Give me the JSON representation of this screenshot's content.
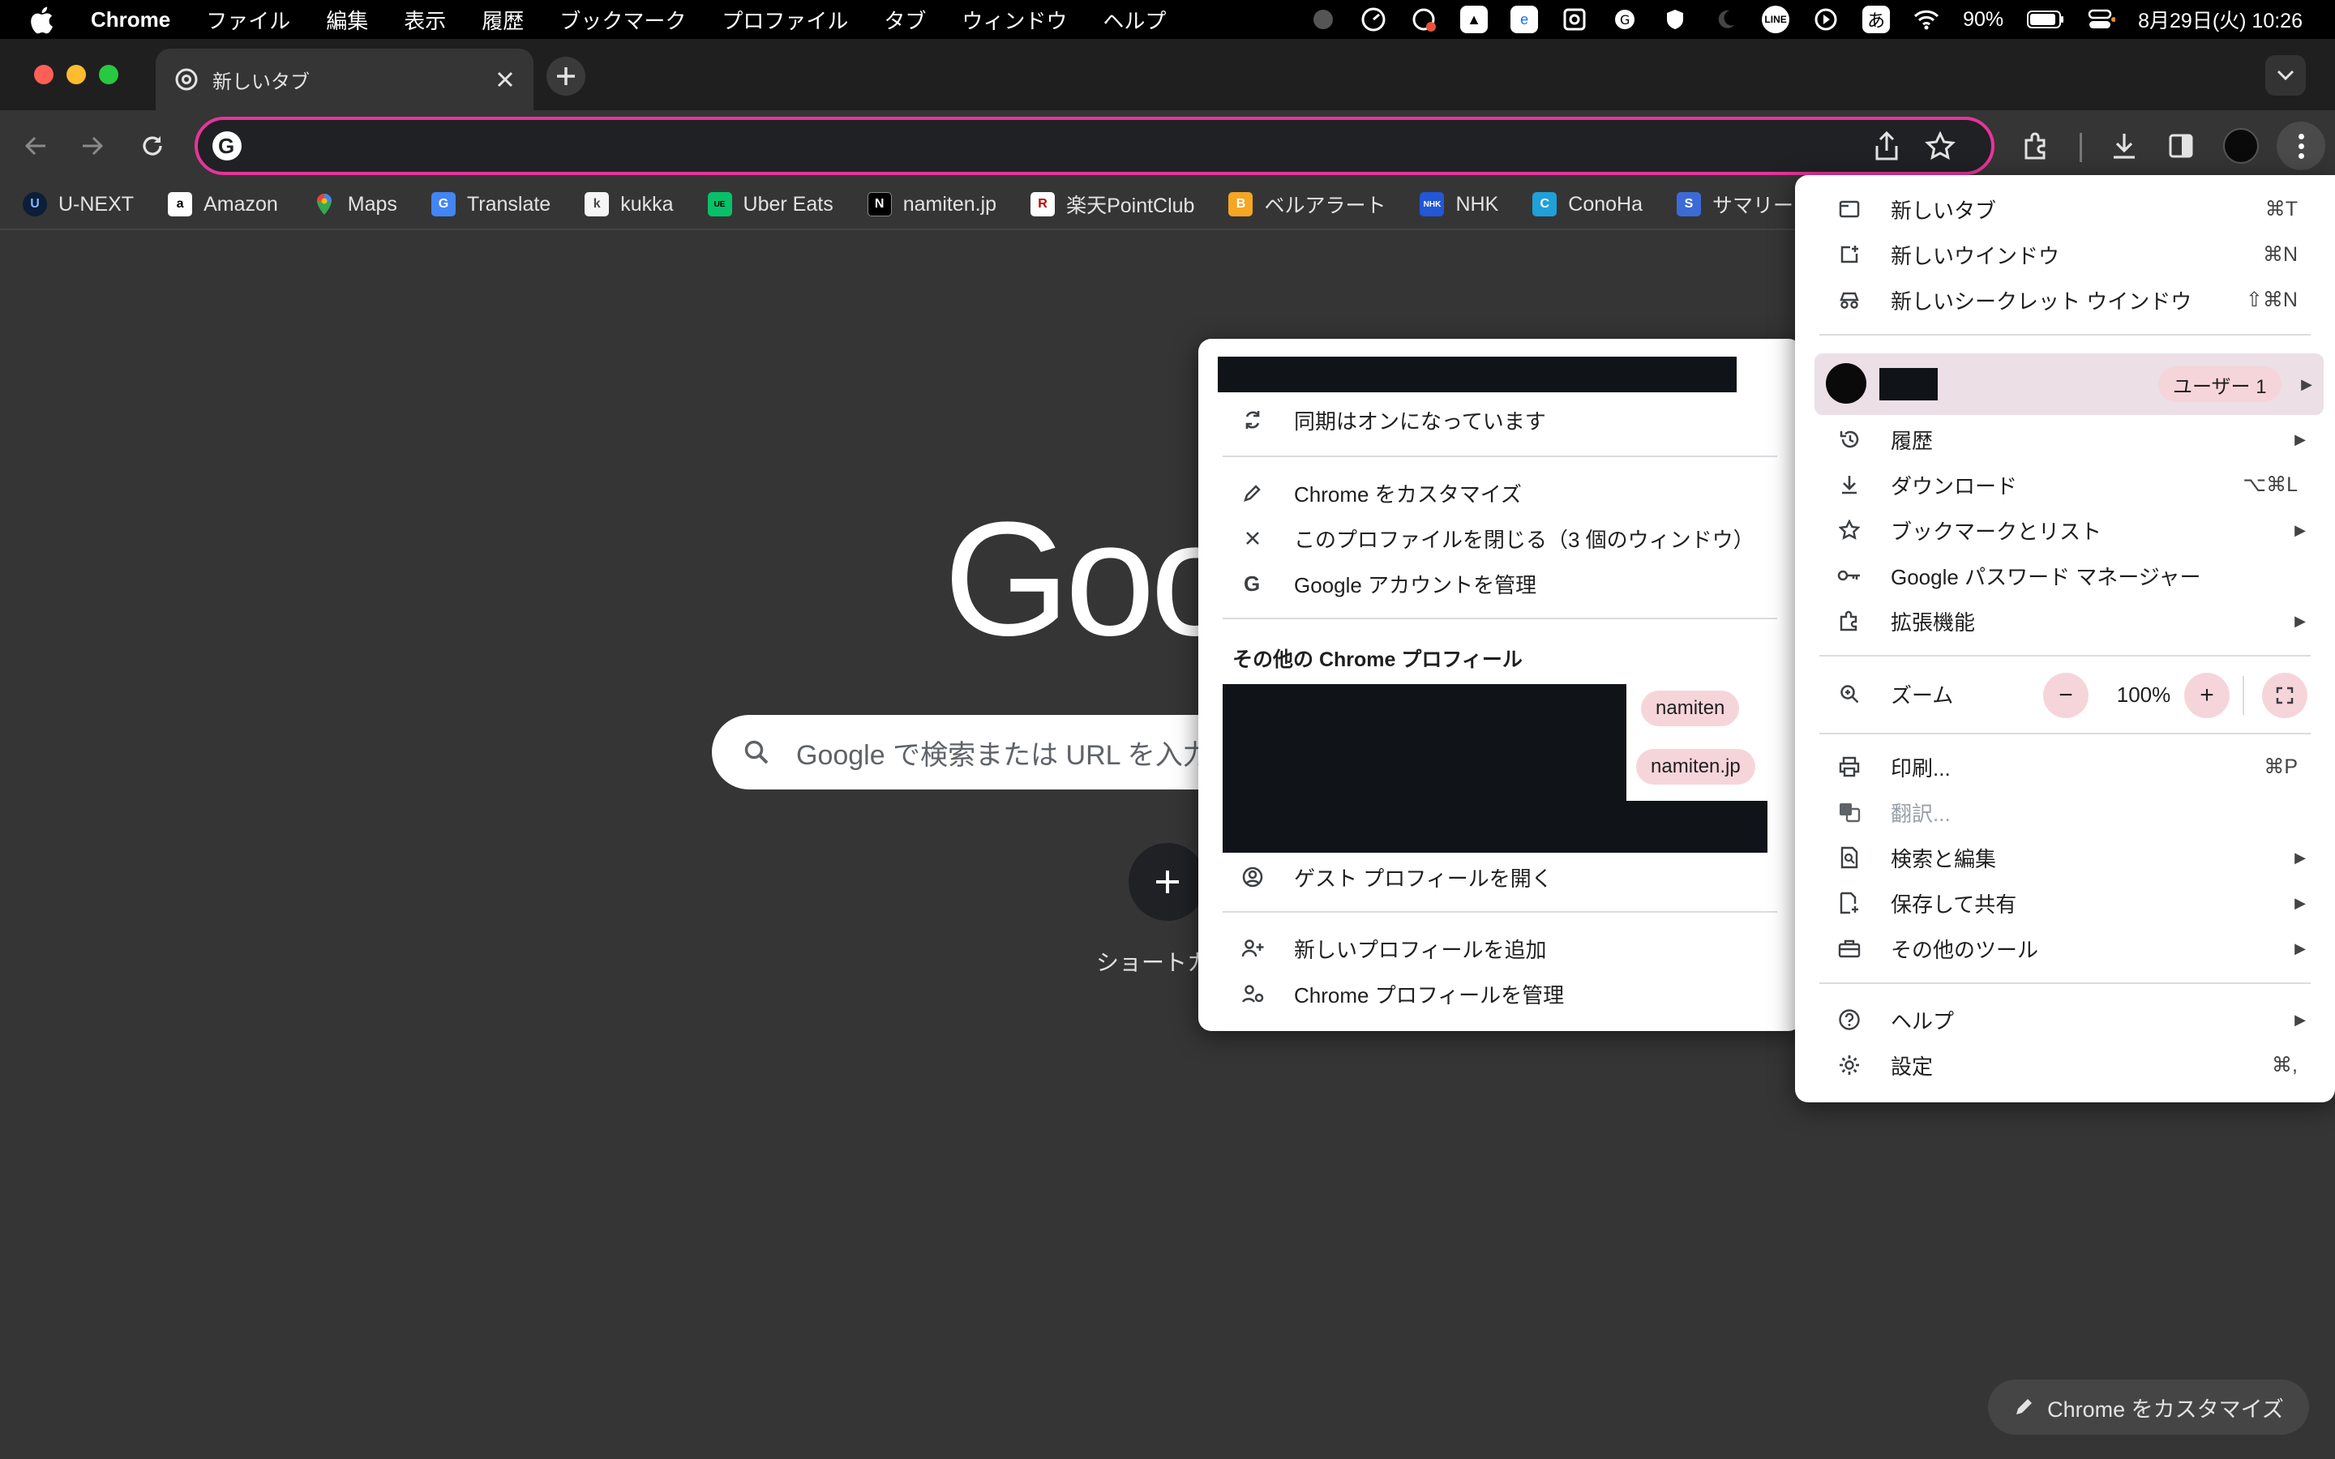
{
  "menubar": {
    "app": "Chrome",
    "items": [
      "ファイル",
      "編集",
      "表示",
      "履歴",
      "ブックマーク",
      "プロファイル",
      "タブ",
      "ウィンドウ",
      "ヘルプ"
    ],
    "battery": "90%",
    "datetime": "8月29日(火) 10:26",
    "ime": "あ"
  },
  "tab": {
    "title": "新しいタブ"
  },
  "bookmarks": [
    {
      "label": "U-NEXT",
      "color": "#0b1e3a",
      "glyph": "U"
    },
    {
      "label": "Amazon",
      "color": "#ffffff",
      "glyph": "a"
    },
    {
      "label": "Maps",
      "color": "#34a853",
      "glyph": "●"
    },
    {
      "label": "Translate",
      "color": "#4285f4",
      "glyph": "G"
    },
    {
      "label": "kukka",
      "color": "#f5f5f5",
      "glyph": "k"
    },
    {
      "label": "Uber Eats",
      "color": "#06c167",
      "glyph": "U"
    },
    {
      "label": "namiten.jp",
      "color": "#000000",
      "glyph": "N"
    },
    {
      "label": "楽天PointClub",
      "color": "#bf0000",
      "glyph": "R"
    },
    {
      "label": "ベルアラート",
      "color": "#f5a623",
      "glyph": "B"
    },
    {
      "label": "NHK",
      "color": "#2257d6",
      "glyph": "N"
    },
    {
      "label": "ConoHa",
      "color": "#1fa0d8",
      "glyph": "C"
    },
    {
      "label": "サマリー",
      "color": "#3b6bd6",
      "glyph": "S"
    }
  ],
  "ntp": {
    "logo": "Goo",
    "search_placeholder": "Google で検索または URL を入力",
    "shortcut_label": "ショートカ",
    "customize_label": "Chrome をカスタマイズ"
  },
  "profile_menu": {
    "sync_status": "同期はオンになっています",
    "customize": "Chrome をカスタマイズ",
    "close_profile": "このプロファイルを閉じる（3 個のウィンドウ）",
    "manage_account": "Google アカウントを管理",
    "other_profiles_heading": "その他の Chrome プロフィール",
    "chips": [
      "namiten",
      "namiten.jp"
    ],
    "guest": "ゲスト プロフィールを開く",
    "add_profile": "新しいプロフィールを追加",
    "manage_profiles": "Chrome プロフィールを管理"
  },
  "main_menu": {
    "new_tab": {
      "label": "新しいタブ",
      "shortcut": "⌘T"
    },
    "new_window": {
      "label": "新しいウインドウ",
      "shortcut": "⌘N"
    },
    "incognito": {
      "label": "新しいシークレット ウインドウ",
      "shortcut": "⇧⌘N"
    },
    "profile_badge": "ユーザー 1",
    "history": "履歴",
    "downloads": {
      "label": "ダウンロード",
      "shortcut": "⌥⌘L"
    },
    "bookmarks": "ブックマークとリスト",
    "passwords": "Google パスワード マネージャー",
    "extensions": "拡張機能",
    "zoom": {
      "label": "ズーム",
      "value": "100%",
      "minus": "−",
      "plus": "+"
    },
    "print": {
      "label": "印刷...",
      "shortcut": "⌘P"
    },
    "translate": "翻訳...",
    "find_edit": "検索と編集",
    "save_share": "保存して共有",
    "more_tools": "その他のツール",
    "help": "ヘルプ",
    "settings": {
      "label": "設定",
      "shortcut": "⌘,"
    }
  },
  "colors": {
    "omnibox_focus": "#e5359a",
    "chip_bg": "#f6d5da",
    "profile_row_bg": "#ecdfe6"
  }
}
